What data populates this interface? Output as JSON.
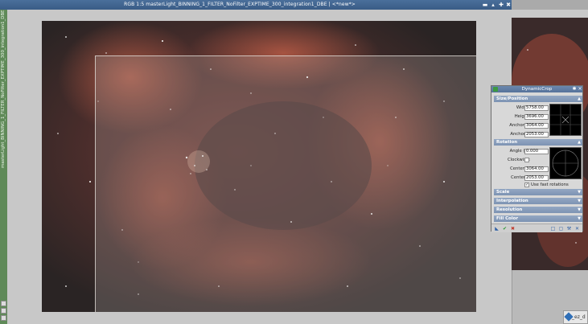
{
  "main_window": {
    "title": "RGB 1:5 masterLight_BINNING_1_FILTER_NoFilter_EXPTIME_300_integration1_DBE | <*new*>",
    "side_label": "masterLight_BINNING_1_FILTER_NoFilter_EXPTIME_300_integration1_DBE",
    "buttons": {
      "shade": "▬",
      "restore": "▴",
      "maximize": "✚",
      "close": "✖"
    }
  },
  "panel": {
    "title": "DynamicCrop",
    "sections": {
      "size_position": "Size/Position",
      "rotation": "Rotation",
      "scale": "Scale",
      "interpolation": "Interpolation",
      "resolution": "Resolution",
      "fill_color": "Fill Color"
    },
    "size": {
      "width_label": "Width:",
      "width": "5758.00",
      "height_label": "Height:",
      "height": "3696.00",
      "anchor_x_label": "Anchor X:",
      "anchor_x": "3064.00",
      "anchor_y_label": "Anchor Y:",
      "anchor_y": "2053.00"
    },
    "rotation": {
      "angle_label": "Angle (°):",
      "angle": "0.000",
      "clockwise_label": "Clockwise:",
      "center_x_label": "Center X:",
      "center_x": "3064.00",
      "center_y_label": "Center Y:",
      "center_y": "2053.00",
      "fast_label": "Use fast rotations",
      "fast_checked": true
    }
  },
  "corner_window": {
    "label": "_ez_d"
  },
  "colors": {
    "titlebar": "#3f628d",
    "section": "#8398b6",
    "nebula": "#9b4a3c"
  }
}
